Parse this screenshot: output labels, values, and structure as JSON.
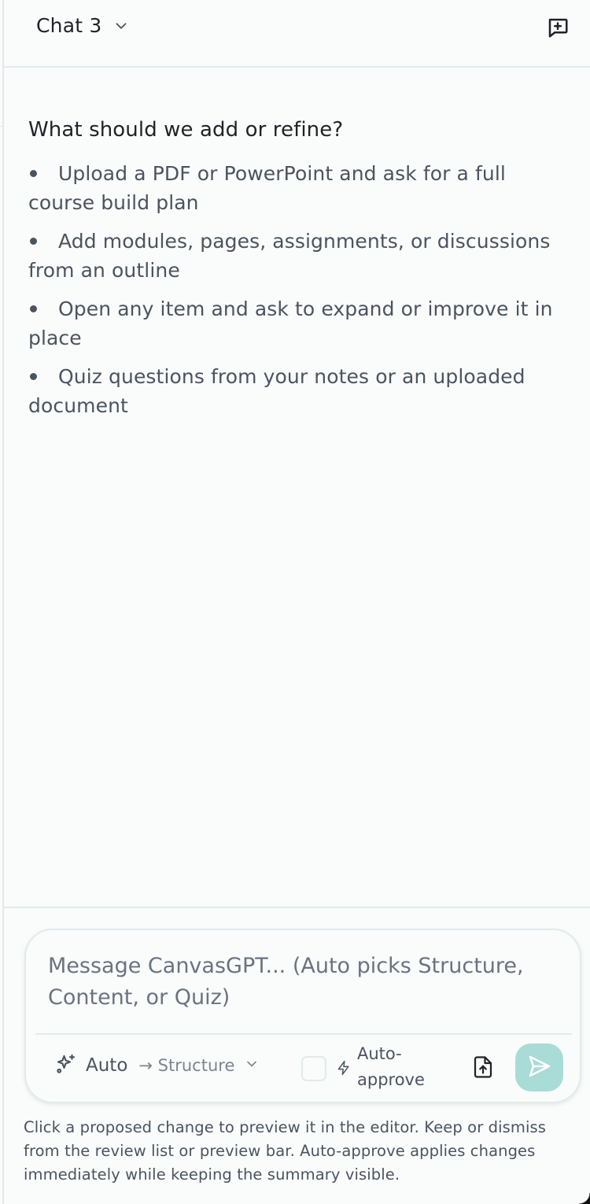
{
  "header": {
    "chat_title": "Chat 3",
    "title_dropdown_icon": "chevron-down-icon",
    "new_chat_icon": "message-plus-icon"
  },
  "main": {
    "heading": "What should we add or refine?",
    "tips": [
      "Upload a PDF or PowerPoint and ask for a full course build plan",
      "Add modules, pages, assignments, or discussions from an outline",
      "Open any item and ask to expand or improve it in place",
      "Quiz questions from your notes or an uploaded document"
    ]
  },
  "composer": {
    "placeholder": "Message CanvasGPT... (Auto picks Structure, Content, or Quiz)",
    "mode_icon": "sparkles-icon",
    "mode_label": "Auto",
    "mode_route": "→ Structure",
    "auto_approve_label": "Auto-approve",
    "auto_approve_checked": false,
    "auto_approve_icon": "bolt-icon",
    "attach_icon": "file-upload-icon",
    "send_icon": "send-icon"
  },
  "footer": {
    "help_text": "Click a proposed change to preview it in the editor. Keep or dismiss from the review list or preview bar. Auto-approve applies changes immediately while keeping the summary visible."
  },
  "colors": {
    "border": "#dfeceb",
    "background": "#fafbfb",
    "send_button": "#a9dcd7",
    "text_primary": "#1f2328",
    "text_secondary": "#4a5460"
  }
}
